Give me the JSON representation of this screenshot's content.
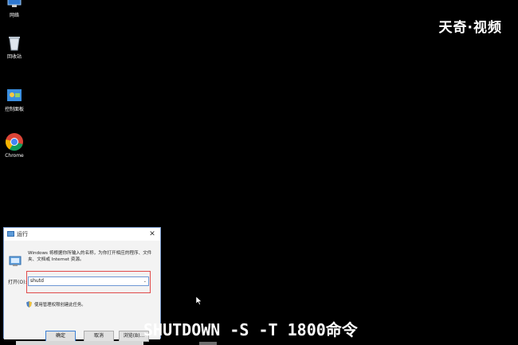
{
  "desktop": {
    "icons": [
      {
        "label": "网络"
      },
      {
        "label": "回收站"
      },
      {
        "label": "控制面板"
      },
      {
        "label": "Chrome"
      }
    ]
  },
  "watermark": "天奇·视频",
  "run_dialog": {
    "title": "运行",
    "close_glyph": "✕",
    "description": "Windows 将根据你所输入的名称，为你打开相应的程序、文件夹、文档或 Internet 资源。",
    "open_label": "打开(O):",
    "input_value": "shutd",
    "admin_note": "使用管理权限创建此任务。",
    "buttons": {
      "ok": "确定",
      "cancel": "取消",
      "browse": "浏览(B)..."
    }
  },
  "subtitle": "SHUTDOWN -S -T 1800命令",
  "colors": {
    "background": "#000000",
    "highlight": "#e04a4a",
    "accent": "#3c7fd3"
  }
}
